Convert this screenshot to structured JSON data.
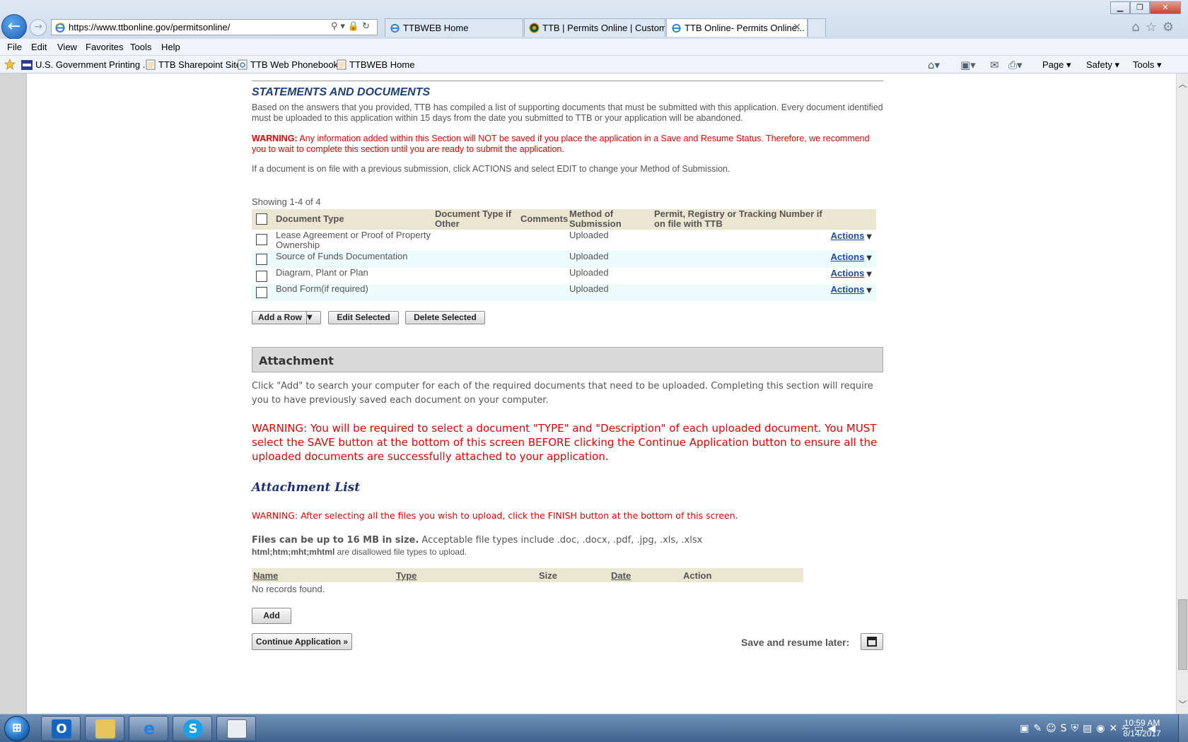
{
  "browser": {
    "url_prefix": "https://www.",
    "url_host": "ttbonline.gov",
    "url_path": "/permitsonline/",
    "tabs": [
      {
        "label": "TTBWEB Home"
      },
      {
        "label": "TTB | Permits Online | Custom..."
      },
      {
        "label": "TTB Online- Permits Online..."
      }
    ],
    "close_tab": "✕"
  },
  "menu": [
    "File",
    "Edit",
    "View",
    "Favorites",
    "Tools",
    "Help"
  ],
  "favorites": [
    {
      "label": "U.S. Government Printing ...",
      "icon": "gpo-icon"
    },
    {
      "label": "TTB Sharepoint Site",
      "icon": "page-icon"
    },
    {
      "label": "TTB Web Phonebook",
      "icon": "ie-icon"
    },
    {
      "label": "TTBWEB Home",
      "icon": "page-icon"
    }
  ],
  "command_bar": {
    "page": "Page",
    "safety": "Safety",
    "tools": "Tools"
  },
  "statements": {
    "title": "STATEMENTS AND DOCUMENTS",
    "intro": "Based on the answers that you provided, TTB has compiled a list of supporting documents that must be submitted with this application. Every document identified must be uploaded to this application within 15 days from the date you submitted to TTB or your application will be abandoned.",
    "warning_label": "WARNING:",
    "warning_text": " Any information added within this Section will NOT be saved if you place the application in a Save and Resume Status. Therefore, we recommend you to wait to complete this section until you are ready to submit the application.",
    "note": "If a document is on file with a previous submission, click ACTIONS and select EDIT to change your Method of Submission.",
    "showing": "Showing 1-4 of 4",
    "columns": {
      "doc_type": "Document Type",
      "doc_type_other": "Document Type if Other",
      "comments": "Comments",
      "method": "Method of Submission",
      "permit": "Permit, Registry or Tracking Number if on file with TTB"
    },
    "rows": [
      {
        "doc_type": "Lease Agreement or Proof of Property Ownership",
        "method": "Uploaded",
        "action": "Actions"
      },
      {
        "doc_type": "Source of Funds Documentation",
        "method": "Uploaded",
        "action": "Actions"
      },
      {
        "doc_type": "Diagram, Plant or Plan",
        "method": "Uploaded",
        "action": "Actions"
      },
      {
        "doc_type": "Bond Form(if required)",
        "method": "Uploaded",
        "action": "Actions"
      }
    ],
    "buttons": {
      "add_row": "Add a Row",
      "edit_selected": "Edit Selected",
      "delete_selected": "Delete Selected"
    }
  },
  "attachment": {
    "title": "Attachment",
    "instructions": "Click \"Add\" to search your computer for each of the required documents that need to be uploaded.  Completing this section will require you to have previously saved each document on your computer.",
    "warning": "WARNING: You will be required to select a document \"TYPE\" and \"Description\" of each uploaded document. You MUST select the SAVE button at the bottom of this screen BEFORE clicking the Continue Application button to ensure all the uploaded documents are successfully attached to your application.",
    "list_title": "Attachment List",
    "list_warning": "WARNING: After selecting all the files you wish to upload, click the FINISH button at the bottom of this screen.",
    "size_bold": "Files can be up to 16 MB in size.",
    "size_rest": " Acceptable file types include .doc, .docx, .pdf, .jpg, .xls, .xlsx",
    "disallowed_bold": "html;htm;mht;mhtml",
    "disallowed_rest": " are disallowed file types to upload.",
    "columns": {
      "name": "Name",
      "type": "Type",
      "size": "Size",
      "date": "Date",
      "action": "Action"
    },
    "empty": "No records found.",
    "add_button": "Add",
    "continue_button": "Continue Application »",
    "save_later": "Save and resume later:"
  },
  "taskbar": {
    "time": "10:59 AM",
    "date": "8/14/2017"
  }
}
